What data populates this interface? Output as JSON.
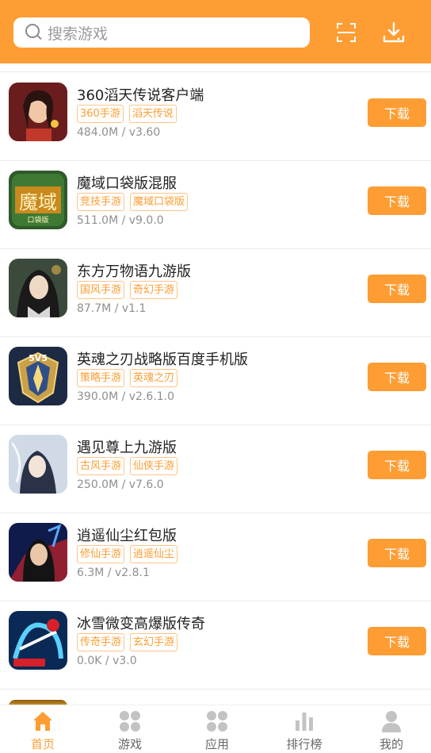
{
  "header": {
    "search_placeholder": "搜索游戏",
    "accent": "#fe9d33"
  },
  "games": [
    {
      "title": "360滔天传说客户端",
      "tags": [
        "360手游",
        "滔天传说"
      ],
      "meta": "484.0M / v3.60",
      "button": "下载"
    },
    {
      "title": "魔域口袋版混服",
      "tags": [
        "竞技手游",
        "魔域口袋版"
      ],
      "meta": "511.0M / v9.0.0",
      "button": "下载"
    },
    {
      "title": "东方万物语九游版",
      "tags": [
        "国风手游",
        "奇幻手游"
      ],
      "meta": "87.7M / v1.1",
      "button": "下载"
    },
    {
      "title": "英魂之刃战略版百度手机版",
      "tags": [
        "策略手游",
        "英魂之刃"
      ],
      "meta": "390.0M / v2.6.1.0",
      "button": "下载"
    },
    {
      "title": "遇见尊上九游版",
      "tags": [
        "古风手游",
        "仙侠手游"
      ],
      "meta": "250.0M / v7.6.0",
      "button": "下载"
    },
    {
      "title": "逍遥仙尘红包版",
      "tags": [
        "修仙手游",
        "逍遥仙尘"
      ],
      "meta": "6.3M / v2.8.1",
      "button": "下载"
    },
    {
      "title": "冰雪微变高爆版传奇",
      "tags": [
        "传奇手游",
        "玄幻手游"
      ],
      "meta": "0.0K / v3.0",
      "button": "下载"
    }
  ],
  "thumb_text": {
    "moyu": "魔域",
    "moyu_sub": "口袋版",
    "yinghun": "5V5"
  },
  "tabbar": [
    {
      "label": "首页",
      "icon": "home-icon",
      "active": true
    },
    {
      "label": "游戏",
      "icon": "grid-icon",
      "active": false
    },
    {
      "label": "应用",
      "icon": "apps-icon",
      "active": false
    },
    {
      "label": "排行榜",
      "icon": "bar-chart-icon",
      "active": false
    },
    {
      "label": "我的",
      "icon": "user-icon",
      "active": false
    }
  ]
}
